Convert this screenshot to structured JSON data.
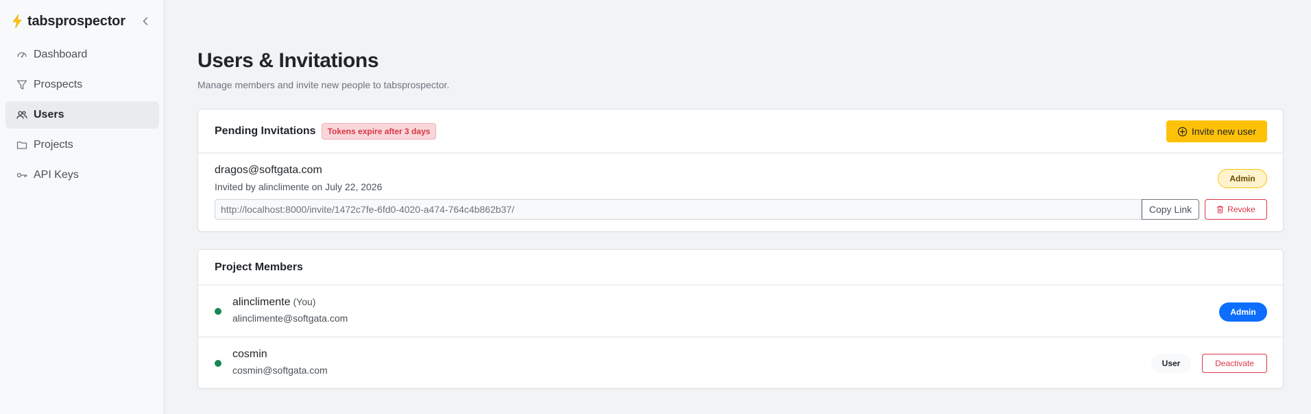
{
  "brand": {
    "name": "tabsprospector",
    "logo_icon": "lightning-bolt-icon",
    "accent": "#ffc107"
  },
  "sidebar": {
    "items": [
      {
        "label": "Dashboard",
        "icon": "gauge-icon",
        "active": false
      },
      {
        "label": "Prospects",
        "icon": "filter-icon",
        "active": false
      },
      {
        "label": "Users",
        "icon": "users-icon",
        "active": true
      },
      {
        "label": "Projects",
        "icon": "folder-icon",
        "active": false
      },
      {
        "label": "API Keys",
        "icon": "key-icon",
        "active": false
      }
    ]
  },
  "page": {
    "title": "Users & Invitations",
    "subtitle": "Manage members and invite new people to tabsprospector."
  },
  "pending": {
    "title": "Pending Invitations",
    "expire_badge": "Tokens expire after 3 days",
    "invite_button": "Invite new user",
    "invitations": [
      {
        "email": "dragos@softgata.com",
        "invited_by": "Invited by alinclimente on July 22, 2026",
        "role": "Admin",
        "link": "http://localhost:8000/invite/1472c7fe-6fd0-4020-a474-764c4b862b37/",
        "copy_label": "Copy Link",
        "revoke_label": "Revoke"
      }
    ]
  },
  "members": {
    "title": "Project Members",
    "list": [
      {
        "name": "alinclimente",
        "you_label": "(You)",
        "email": "alinclimente@softgata.com",
        "role": "Admin",
        "status": "active"
      },
      {
        "name": "cosmin",
        "email": "cosmin@softgata.com",
        "role": "User",
        "action": "Deactivate",
        "status": "active"
      }
    ]
  },
  "colors": {
    "primary": "#0d6efd",
    "danger": "#dc3545",
    "warning": "#ffc107",
    "success": "#198754"
  }
}
